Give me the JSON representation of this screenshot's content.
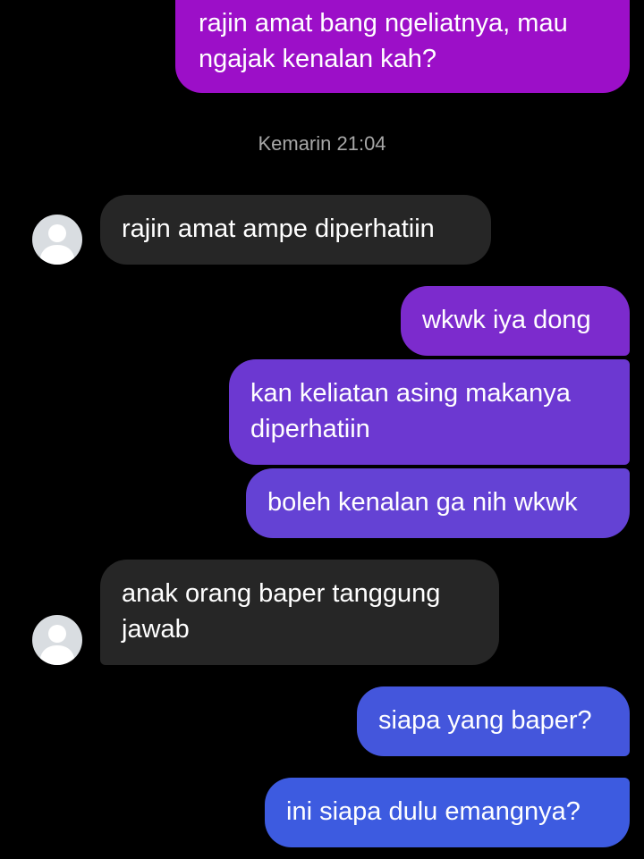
{
  "conversation": {
    "timestamp": "Kemarin 21:04",
    "messages": [
      {
        "from": "me",
        "text": "rajin amat bang ngeliatnya, mau ngajak kenalan kah?"
      },
      {
        "from": "them",
        "text": "rajin amat ampe diperhatiin"
      },
      {
        "from": "me",
        "text": "wkwk iya dong"
      },
      {
        "from": "me",
        "text": "kan keliatan asing makanya diperhatiin"
      },
      {
        "from": "me",
        "text": "boleh kenalan ga nih wkwk"
      },
      {
        "from": "them",
        "text": "anak orang baper tanggung jawab"
      },
      {
        "from": "me",
        "text": "siapa yang baper?"
      },
      {
        "from": "me",
        "text": "ini siapa dulu emangnya?"
      }
    ]
  },
  "icons": {
    "avatar": "default-user-avatar-icon"
  },
  "colors": {
    "background": "#000000",
    "incoming_bubble": "#262626",
    "timestamp": "#a7a7a7",
    "outgoing_gradient_top": "#9b10c7",
    "outgoing_gradient_mid": "#6a3ed3",
    "outgoing_gradient_bottom": "#3d5be0"
  }
}
